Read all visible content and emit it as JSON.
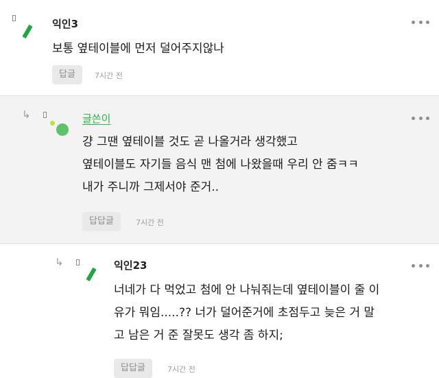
{
  "comments": [
    {
      "nickname": "익인3",
      "text": "보통 옆테이블에 먼저 덜어주지않나",
      "reply_label": "답글",
      "time": "7시간 전"
    },
    {
      "nickname": "글쓴이",
      "text": "걍 그땐 옆테이블 것도 곧 나올거라 생각했고\n옆테이블도 자기들 음식 맨 첨에 나왔을때 우리 안 줌ㅋㅋ\n내가 주니까 그제서야 준거..",
      "reply_label": "답답글",
      "time": "7시간 전"
    },
    {
      "nickname": "익인23",
      "text": "너네가 다 먹었고 첨에 안 나눠줘는데 옆테이블이 줄 이\n유가 뭐임.....?? 너가 덜어준거에 초점두고 늦은 거 말\n고 남은 거 준 잘못도 생각 좀 하지;",
      "reply_label": "답답글",
      "time": "7시간 전"
    }
  ],
  "icons": {
    "reply_arrow": "reply-arrow-icon",
    "more": "more-options-icon",
    "avatar": "avatar-icon"
  },
  "colors": {
    "accent_green": "#2bb44a",
    "avatar_green": "#22a447",
    "highlight_bg": "#f3f3f3"
  }
}
